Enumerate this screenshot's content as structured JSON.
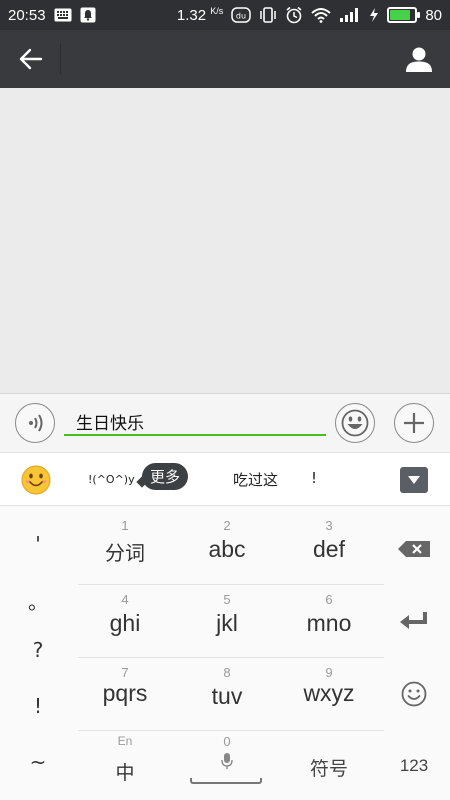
{
  "status_bar": {
    "time": "20:53",
    "net_speed": "1.32",
    "net_unit": "K/s",
    "app_badge": "du",
    "battery_level": 0.8,
    "battery_text": "80"
  },
  "input_bar": {
    "message_text": "生日快乐"
  },
  "candidate_bar": {
    "kaomoji": "!(^O^)y",
    "tooltip": "更多",
    "candidates": [
      "吃过这",
      "!"
    ]
  },
  "keyboard": {
    "punctuation": [
      "'",
      "。",
      "?",
      "!",
      "~"
    ],
    "keys": [
      {
        "num": "1",
        "label": "分词"
      },
      {
        "num": "2",
        "label": "abc"
      },
      {
        "num": "3",
        "label": "def"
      },
      {
        "num": "4",
        "label": "ghi"
      },
      {
        "num": "5",
        "label": "jkl"
      },
      {
        "num": "6",
        "label": "mno"
      },
      {
        "num": "7",
        "label": "pqrs"
      },
      {
        "num": "8",
        "label": "tuv"
      },
      {
        "num": "9",
        "label": "wxyz"
      }
    ],
    "lang_top": "En",
    "lang_main": "中",
    "space_num": "0",
    "symbols_label": "符号",
    "numbers_label": "123"
  },
  "colors": {
    "header_bg": "#393a3e",
    "status_bg": "#2f3033",
    "accent_green": "#45c01a",
    "battery_green": "#47d14a"
  },
  "icons": [
    "back-arrow-icon",
    "person-icon",
    "voice-icon",
    "emoji-icon",
    "plus-icon",
    "smiley-icon",
    "chevron-down-icon",
    "backspace-icon",
    "enter-icon",
    "mic-icon"
  ]
}
